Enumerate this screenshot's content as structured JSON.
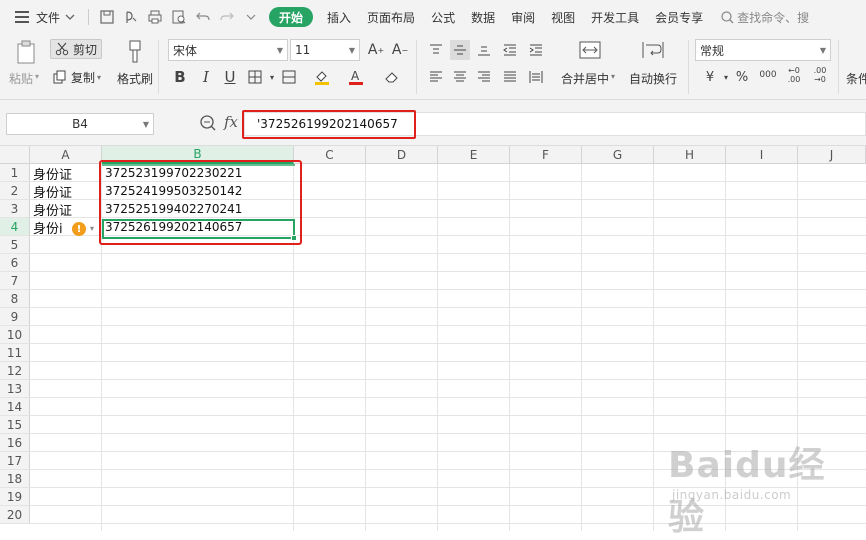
{
  "menu": {
    "file_label": "文件",
    "tabs": [
      "开始",
      "插入",
      "页面布局",
      "公式",
      "数据",
      "审阅",
      "视图",
      "开发工具",
      "会员专享"
    ],
    "active_tab": "开始",
    "search_placeholder": "查找命令、搜"
  },
  "ribbon": {
    "paste_label": "粘贴",
    "cut_label": "剪切",
    "copy_label": "复制",
    "format_painter_label": "格式刷",
    "font_name": "宋体",
    "font_size": "11",
    "merge_center_label": "合并居中",
    "wrap_text_label": "自动换行",
    "number_format": "常规",
    "conditional_label": "条件",
    "currency_symbol": "¥",
    "percent_symbol": "%",
    "thousands_symbol": "000",
    "inc_decimal": "←0 .00",
    "dec_decimal": ".00 →0"
  },
  "formula_bar": {
    "name_box": "B4",
    "fx_label": "fx",
    "content": "'372526199202140657"
  },
  "grid": {
    "columns": [
      "A",
      "B",
      "C",
      "D",
      "E",
      "F",
      "G",
      "H",
      "I",
      "J"
    ],
    "active_column": "B",
    "rows": [
      "1",
      "2",
      "3",
      "4",
      "5",
      "6",
      "7",
      "8",
      "9",
      "10",
      "11",
      "12",
      "13",
      "14",
      "15",
      "16",
      "17",
      "18",
      "19",
      "20"
    ],
    "active_row": "4",
    "cells": [
      {
        "row": 1,
        "a": "身份证",
        "b": "372523199702230221"
      },
      {
        "row": 2,
        "a": "身份证",
        "b": "372524199503250142"
      },
      {
        "row": 3,
        "a": "身份证",
        "b": "372525199402270241"
      },
      {
        "row": 4,
        "a": "身份i",
        "b": "372526199202140657"
      }
    ],
    "warning_glyph": "!"
  },
  "watermark": {
    "logo": "Baidu经验",
    "sub": "jingyan.baidu.com"
  }
}
